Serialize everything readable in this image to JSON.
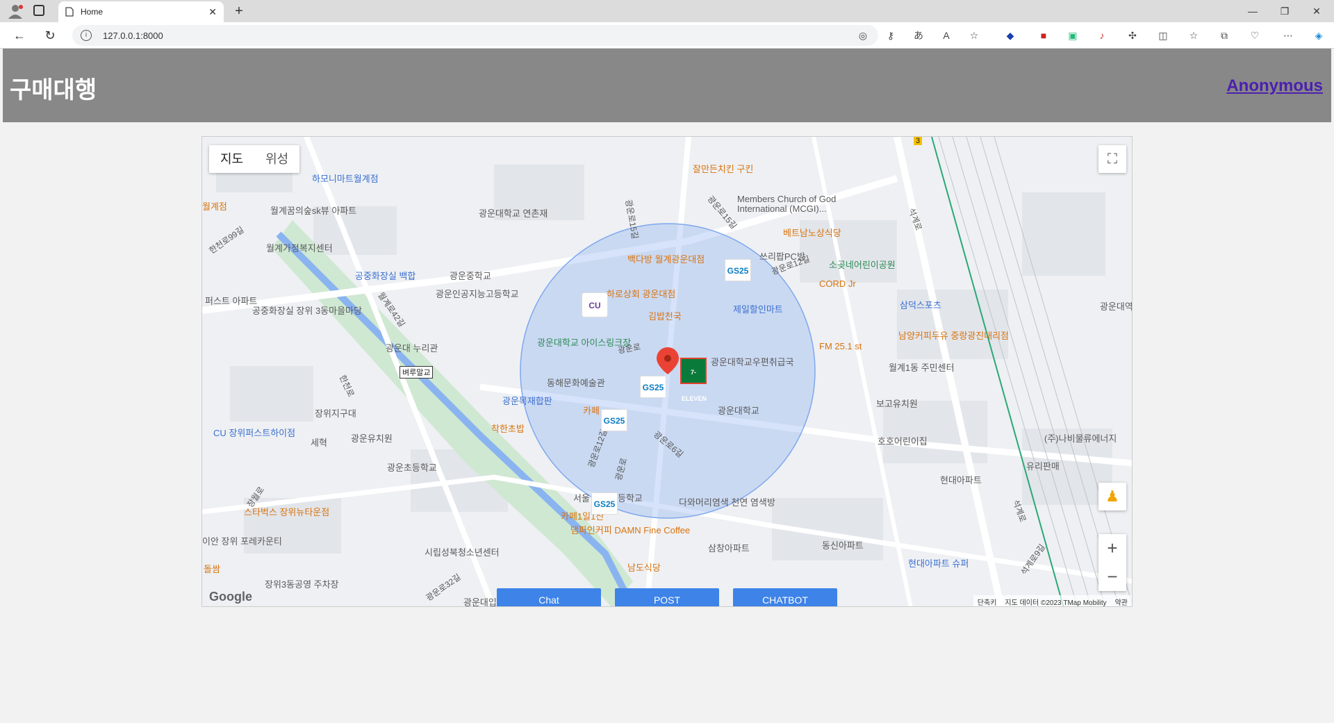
{
  "browser": {
    "tab_title": "Home",
    "url": "127.0.0.1:8000"
  },
  "header": {
    "brand": "구매대행",
    "user_link": "Anonymous"
  },
  "map": {
    "type_buttons": [
      "지도",
      "위성"
    ],
    "places": [
      {
        "text": "하모니마트월계점",
        "color": "blue"
      },
      {
        "text": "월계꿈의숲sk뷰 아파트",
        "color": "gray"
      },
      {
        "text": "월계가정복지센터",
        "color": "gray"
      },
      {
        "text": "공중화장실 백합",
        "color": "blue"
      },
      {
        "text": "광운대학교 연촌재",
        "color": "gray"
      },
      {
        "text": "광운중학교",
        "color": "gray"
      },
      {
        "text": "광운인공지능고등학교",
        "color": "gray"
      },
      {
        "text": "잘만든치킨 구킨",
        "color": "orange"
      },
      {
        "text": "Members Church of God",
        "color": "gray"
      },
      {
        "text": "International (MCGI)...",
        "color": "gray"
      },
      {
        "text": "베트남노상식당",
        "color": "orange"
      },
      {
        "text": "백다방 월계광운대점",
        "color": "orange"
      },
      {
        "text": "쓰리팝PC방",
        "color": "gray"
      },
      {
        "text": "소곶네어린이공원",
        "color": "green"
      },
      {
        "text": "CORD Jr",
        "color": "orange"
      },
      {
        "text": "하로상회 광운대점",
        "color": "orange"
      },
      {
        "text": "김밥천국",
        "color": "orange"
      },
      {
        "text": "제일할인마트",
        "color": "blue"
      },
      {
        "text": "삼덕스포츠",
        "color": "blue"
      },
      {
        "text": "광운대학교 아이스링크장",
        "color": "green"
      },
      {
        "text": "광운대학교우편취급국",
        "color": "gray"
      },
      {
        "text": "FM 25.1 st",
        "color": "orange"
      },
      {
        "text": "남양커피두유 중랑광진대리점",
        "color": "orange"
      },
      {
        "text": "월계1동 주민센터",
        "color": "gray"
      },
      {
        "text": "광운대 누리관",
        "color": "gray"
      },
      {
        "text": "동해문화예술관",
        "color": "gray"
      },
      {
        "text": "광운목재합판",
        "color": "blue"
      },
      {
        "text": "보고유치원",
        "color": "gray"
      },
      {
        "text": "장위지구대",
        "color": "gray"
      },
      {
        "text": "광운대학교",
        "color": "gray"
      },
      {
        "text": "착한초밥",
        "color": "orange"
      },
      {
        "text": "카페",
        "color": "orange"
      },
      {
        "text": "CU 장위퍼스트하이점",
        "color": "blue"
      },
      {
        "text": "세혁",
        "color": "gray"
      },
      {
        "text": "광운유치원",
        "color": "gray"
      },
      {
        "text": "호호어린이집",
        "color": "gray"
      },
      {
        "text": "(주)나비물류에너지",
        "color": "gray"
      },
      {
        "text": "광운초등학교",
        "color": "gray"
      },
      {
        "text": "유리판매",
        "color": "gray"
      },
      {
        "text": "현대아파트",
        "color": "gray"
      },
      {
        "text": "스타벅스 장위뉴타운점",
        "color": "orange"
      },
      {
        "text": "서울",
        "color": "gray"
      },
      {
        "text": "등학교",
        "color": "gray"
      },
      {
        "text": "다와머리염색 천연 염색방",
        "color": "gray"
      },
      {
        "text": "카페1일1산",
        "color": "orange"
      },
      {
        "text": "이안 장위 포레카운티",
        "color": "gray"
      },
      {
        "text": "댐파인커피 DAMN Fine Coffee",
        "color": "orange"
      },
      {
        "text": "삼창아파트",
        "color": "gray"
      },
      {
        "text": "동신아파트",
        "color": "gray"
      },
      {
        "text": "시립성북청소년센터",
        "color": "gray"
      },
      {
        "text": "현대아파트 슈퍼",
        "color": "blue"
      },
      {
        "text": "남도식당",
        "color": "orange"
      },
      {
        "text": "장위3동공영 주차장",
        "color": "gray"
      },
      {
        "text": "광운대역",
        "color": "gray"
      },
      {
        "text": "퍼스트 아파트",
        "color": "gray"
      },
      {
        "text": "공중화장실 장위 3동마을마당",
        "color": "gray"
      },
      {
        "text": "월계점",
        "color": "orange"
      },
      {
        "text": "돌쌈",
        "color": "orange"
      },
      {
        "text": "광운대입",
        "color": "gray"
      }
    ],
    "streets": [
      "한천로99길",
      "월계로42길",
      "한천로",
      "광운로15길",
      "광운로15길",
      "광운로12길",
      "석계로",
      "광운로",
      "광운로12길",
      "광운로",
      "광운로6길",
      "장월로",
      "석계로",
      "석계로9길",
      "광운로32길",
      "벼루말교",
      "3"
    ],
    "stores": [
      "GS25",
      "GS25",
      "GS25",
      "GS25",
      "CU",
      "7-ELEVEN"
    ],
    "buttons": {
      "chat": "Chat",
      "post": "POST",
      "chatbot": "CHATBOT"
    },
    "google_logo": "Google",
    "attribution": [
      "단축키",
      "지도 데이터 ©2023 TMap Mobility",
      "약관"
    ],
    "accent_color": "#3d83e8",
    "circle_color": "#7ea7ee"
  }
}
